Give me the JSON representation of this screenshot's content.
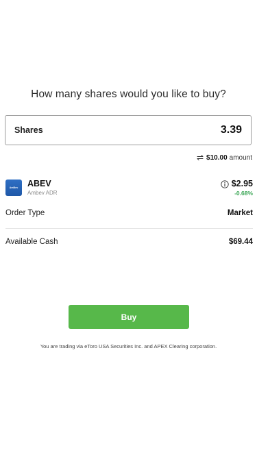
{
  "question": "How many shares would you like to buy?",
  "shares": {
    "label": "Shares",
    "value": "3.39"
  },
  "amount": {
    "icon": "swap-icon",
    "value": "$10.00",
    "unit": "amount"
  },
  "asset": {
    "logo_text": "AmBev",
    "ticker": "ABEV",
    "name": "Ambev ADR",
    "info_icon": "info-icon",
    "price": "$2.95",
    "change": "-0.68%",
    "change_color": "#3aa655"
  },
  "order_type": {
    "label": "Order Type",
    "value": "Market"
  },
  "available_cash": {
    "label": "Available Cash",
    "value": "$69.44"
  },
  "buy_button": {
    "label": "Buy",
    "color": "#57b84a"
  },
  "disclaimer": "You are trading via eToro USA Securities Inc. and APEX Clearing corporation."
}
